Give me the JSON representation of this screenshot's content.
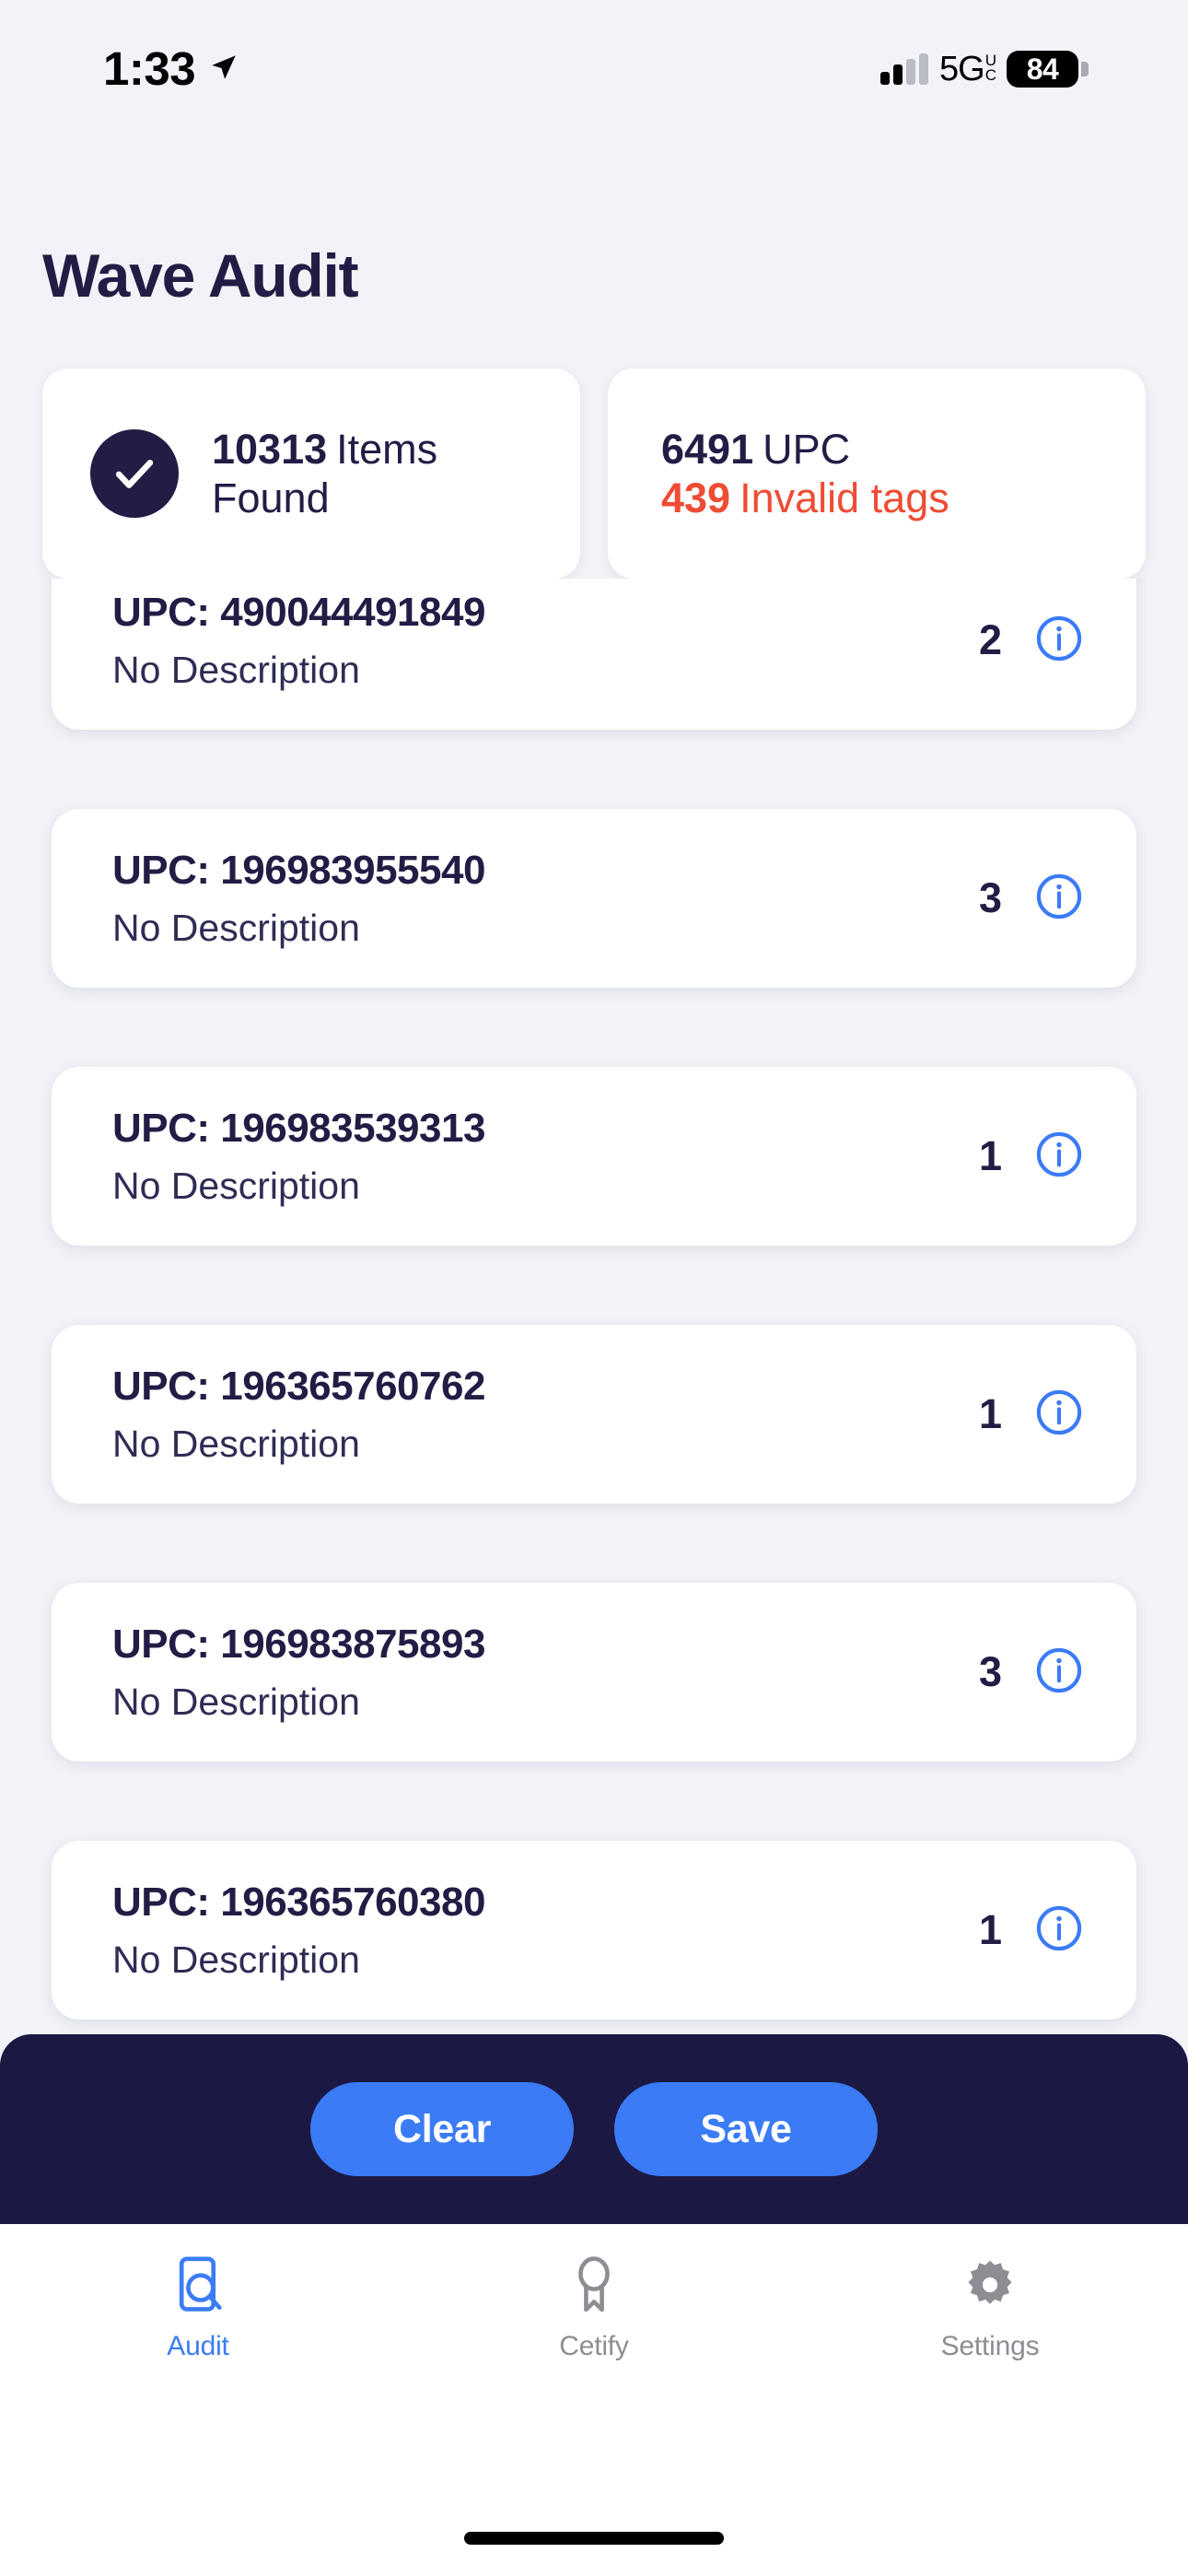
{
  "status_bar": {
    "time": "1:33",
    "location_icon": "location-arrow-icon",
    "network": "5G",
    "network_sub_top": "U",
    "network_sub_bottom": "C",
    "battery_level": "84"
  },
  "header": {
    "title": "Wave Audit"
  },
  "summary": {
    "found_card": {
      "icon": "check-circle-icon",
      "count": "10313",
      "unit": "Items",
      "status": "Found"
    },
    "upc_card": {
      "count": "6491",
      "unit": "UPC",
      "invalid_count": "439",
      "invalid_label": "Invalid tags",
      "invalid_color": "#ee4c34"
    }
  },
  "list": {
    "upc_prefix": "UPC: ",
    "items": [
      {
        "upc": "UPC: 490044491849",
        "description": "No Description",
        "count": "2",
        "info_icon": "info-circle-icon"
      },
      {
        "upc": "UPC: 196983955540",
        "description": "No Description",
        "count": "3",
        "info_icon": "info-circle-icon"
      },
      {
        "upc": "UPC: 196983539313",
        "description": "No Description",
        "count": "1",
        "info_icon": "info-circle-icon"
      },
      {
        "upc": "UPC: 196365760762",
        "description": "No Description",
        "count": "1",
        "info_icon": "info-circle-icon"
      },
      {
        "upc": "UPC: 196983875893",
        "description": "No Description",
        "count": "3",
        "info_icon": "info-circle-icon"
      },
      {
        "upc": "UPC: 196365760380",
        "description": "No Description",
        "count": "1",
        "info_icon": "info-circle-icon"
      }
    ]
  },
  "actions": {
    "clear_label": "Clear",
    "save_label": "Save",
    "bar_color": "#1b1944",
    "button_color": "#3b7bf6"
  },
  "tab_bar": {
    "active_color": "#3b7bf6",
    "inactive_color": "#8d8d93",
    "tabs": [
      {
        "label": "Audit",
        "icon": "document-search-icon",
        "active": true
      },
      {
        "label": "Cetify",
        "icon": "award-ribbon-icon",
        "active": false
      },
      {
        "label": "Settings",
        "icon": "gear-icon",
        "active": false
      }
    ]
  }
}
